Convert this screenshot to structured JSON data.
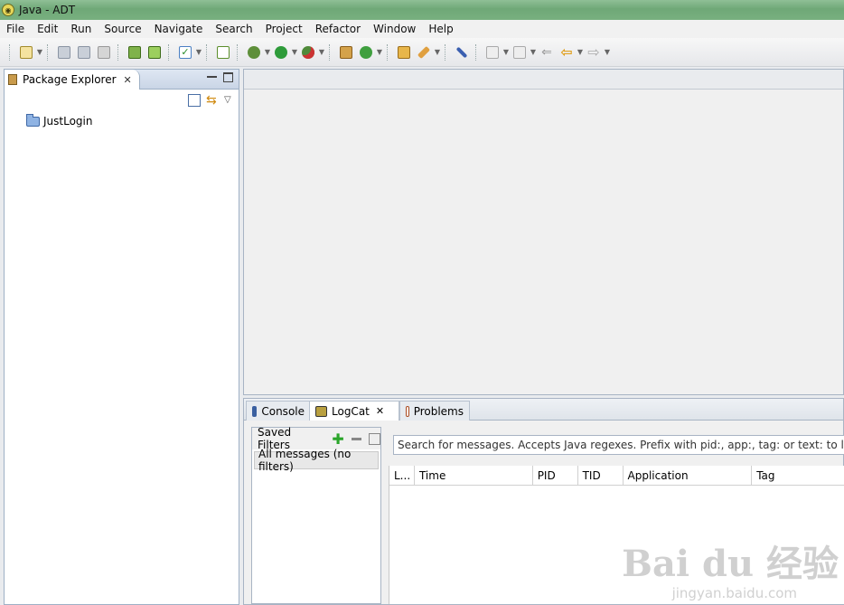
{
  "window": {
    "title": "Java - ADT"
  },
  "menu": [
    "File",
    "Edit",
    "Run",
    "Source",
    "Navigate",
    "Search",
    "Project",
    "Refactor",
    "Window",
    "Help"
  ],
  "toolbar_icons": [
    "new-wizard-icon",
    "save-icon",
    "save-all-icon",
    "print-icon",
    "android-sdk-manager-icon",
    "android-avd-manager-icon",
    "lint-check-icon",
    "new-android-project-icon",
    "debug-icon",
    "run-icon",
    "external-tools-icon",
    "new-java-package-icon",
    "new-java-class-icon",
    "open-type-icon",
    "search-icon",
    "toggle-mark-occurrences-icon",
    "next-annotation-icon",
    "previous-annotation-icon",
    "last-edit-location-icon",
    "back-icon",
    "forward-icon"
  ],
  "package_explorer": {
    "tab_label": "Package Explorer",
    "projects": [
      "JustLogin"
    ]
  },
  "bottom_tabs": {
    "console": "Console",
    "logcat": "LogCat",
    "problems": "Problems"
  },
  "logcat": {
    "saved_filters_label": "Saved Filters",
    "filters": [
      "All messages (no filters)"
    ],
    "search_placeholder": "Search for messages. Accepts Java regexes. Prefix with pid:, app:, tag: or text: to limit scope.",
    "columns": [
      "L...",
      "Time",
      "PID",
      "TID",
      "Application",
      "Tag"
    ]
  },
  "watermark": {
    "main": "Bai du 经验",
    "sub": "jingyan.baidu.com"
  }
}
